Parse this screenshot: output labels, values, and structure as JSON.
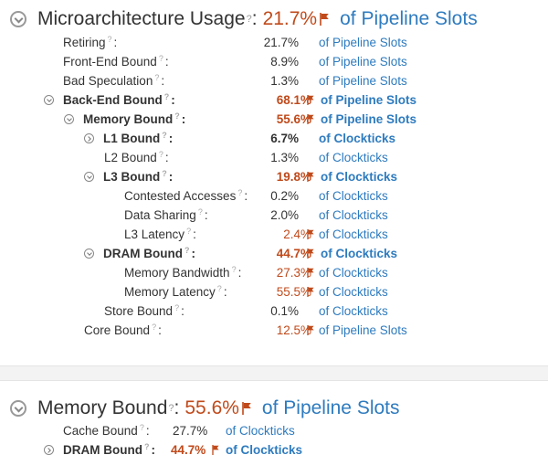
{
  "summary": {
    "title": "Microarchitecture Usage",
    "value": "21.7%",
    "unit": "of Pipeline Slots",
    "rows": [
      {
        "label": "Retiring",
        "value": "21.7%",
        "unit": "of Pipeline Slots"
      },
      {
        "label": "Front-End Bound",
        "value": "8.9%",
        "unit": "of Pipeline Slots"
      },
      {
        "label": "Bad Speculation",
        "value": "1.3%",
        "unit": "of Pipeline Slots"
      },
      {
        "label": "Back-End Bound",
        "value": "68.1%",
        "unit": "of Pipeline Slots"
      },
      {
        "label": "Memory Bound",
        "value": "55.6%",
        "unit": "of Pipeline Slots"
      },
      {
        "label": "L1 Bound",
        "value": "6.7%",
        "unit": "of Clockticks"
      },
      {
        "label": "L2 Bound",
        "value": "1.3%",
        "unit": "of Clockticks"
      },
      {
        "label": "L3 Bound",
        "value": "19.8%",
        "unit": "of Clockticks"
      },
      {
        "label": "Contested Accesses",
        "value": "0.2%",
        "unit": "of Clockticks"
      },
      {
        "label": "Data Sharing",
        "value": "2.0%",
        "unit": "of Clockticks"
      },
      {
        "label": "L3 Latency",
        "value": "2.4%",
        "unit": "of Clockticks"
      },
      {
        "label": "DRAM Bound",
        "value": "44.7%",
        "unit": "of Clockticks"
      },
      {
        "label": "Memory Bandwidth",
        "value": "27.3%",
        "unit": "of Clockticks"
      },
      {
        "label": "Memory Latency",
        "value": "55.5%",
        "unit": "of Clockticks"
      },
      {
        "label": "Store Bound",
        "value": "0.1%",
        "unit": "of Clockticks"
      },
      {
        "label": "Core Bound",
        "value": "12.5%",
        "unit": "of Pipeline Slots"
      }
    ]
  },
  "memory": {
    "title": "Memory Bound",
    "value": "55.6%",
    "unit": "of Pipeline Slots",
    "rows": [
      {
        "label": "Cache Bound",
        "value": "27.7%",
        "unit": "of Clockticks"
      },
      {
        "label": "DRAM Bound",
        "value": "44.7%",
        "unit": "of Clockticks"
      }
    ]
  },
  "colors": {
    "flag": "#c04a1b",
    "link": "#2e7bbf"
  }
}
